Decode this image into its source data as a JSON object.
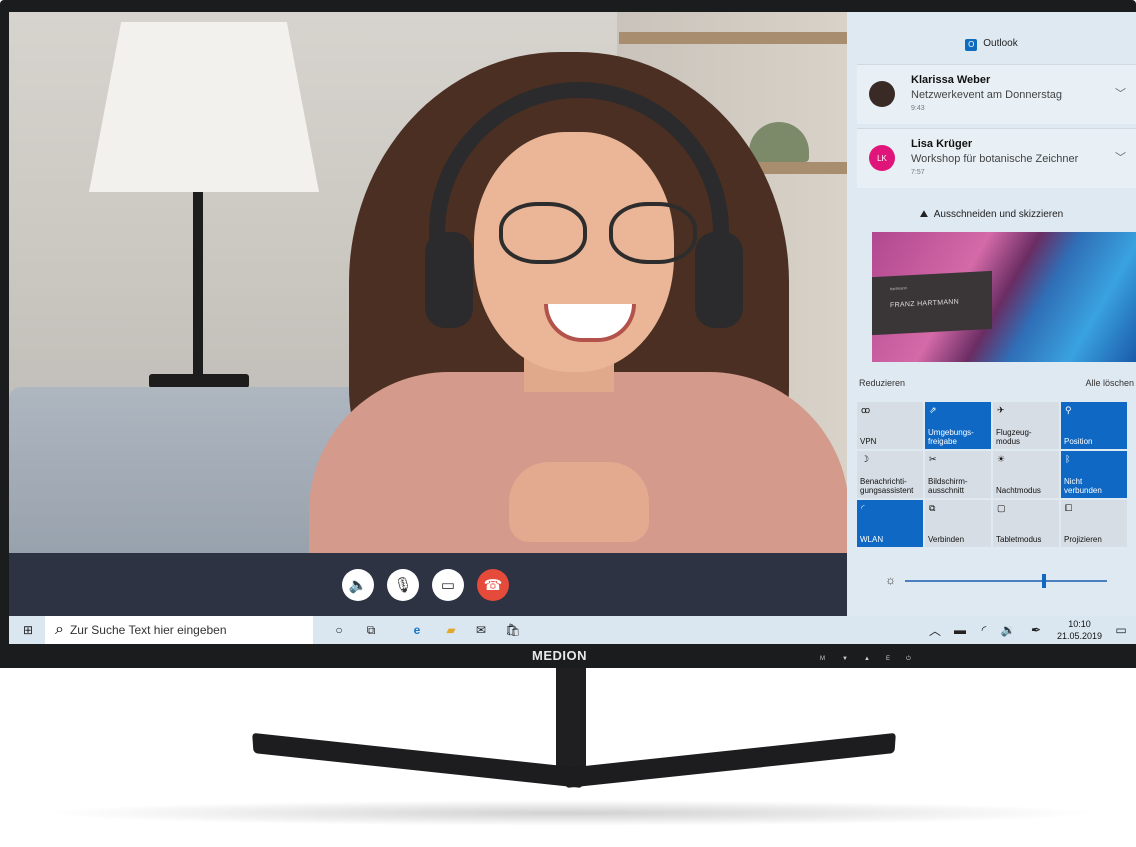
{
  "outlook": {
    "header": "Outlook",
    "notifications": [
      {
        "sender": "Klarissa Weber",
        "subject": "Netzwerkevent am Donnerstag",
        "time": "9:43",
        "initials": ""
      },
      {
        "sender": "Lisa Krüger",
        "subject": "Workshop für botanische Zeichner",
        "time": "7:57",
        "initials": "LK"
      }
    ]
  },
  "snip": {
    "header": "Ausschneiden und skizzieren",
    "card_name": "FRANZ HARTMANN",
    "card_small": "hartmann"
  },
  "action_center": {
    "collapse_label": "Reduzieren",
    "clear_label": "Alle löschen",
    "tiles": [
      {
        "label": "VPN",
        "on": false
      },
      {
        "label": "Umgebungs-\nfreigabe",
        "on": true
      },
      {
        "label": "Flugzeug-\nmodus",
        "on": false
      },
      {
        "label": "Position",
        "on": true
      },
      {
        "label": "Benachrichti-\ngungsassistent",
        "on": false
      },
      {
        "label": "Bildschirm-\nausschnitt",
        "on": false
      },
      {
        "label": "Nachtmodus",
        "on": false
      },
      {
        "label": "Nicht\nverbunden",
        "on": true
      },
      {
        "label": "WLAN",
        "on": true
      },
      {
        "label": "Verbinden",
        "on": false
      },
      {
        "label": "Tabletmodus",
        "on": false
      },
      {
        "label": "Projizieren",
        "on": false
      }
    ]
  },
  "taskbar": {
    "search_placeholder": "Zur Suche Text hier eingeben",
    "time": "10:10",
    "date": "21.05.2019"
  },
  "monitor": {
    "brand": "MEDION",
    "osd_buttons": [
      "M",
      "▼",
      "▲",
      "E",
      "⏻"
    ]
  },
  "colors": {
    "accent": "#0e68c4",
    "end_call": "#e64a3b",
    "action_center_bg": "#dfe9f1",
    "call_bar": "#2d3342"
  }
}
